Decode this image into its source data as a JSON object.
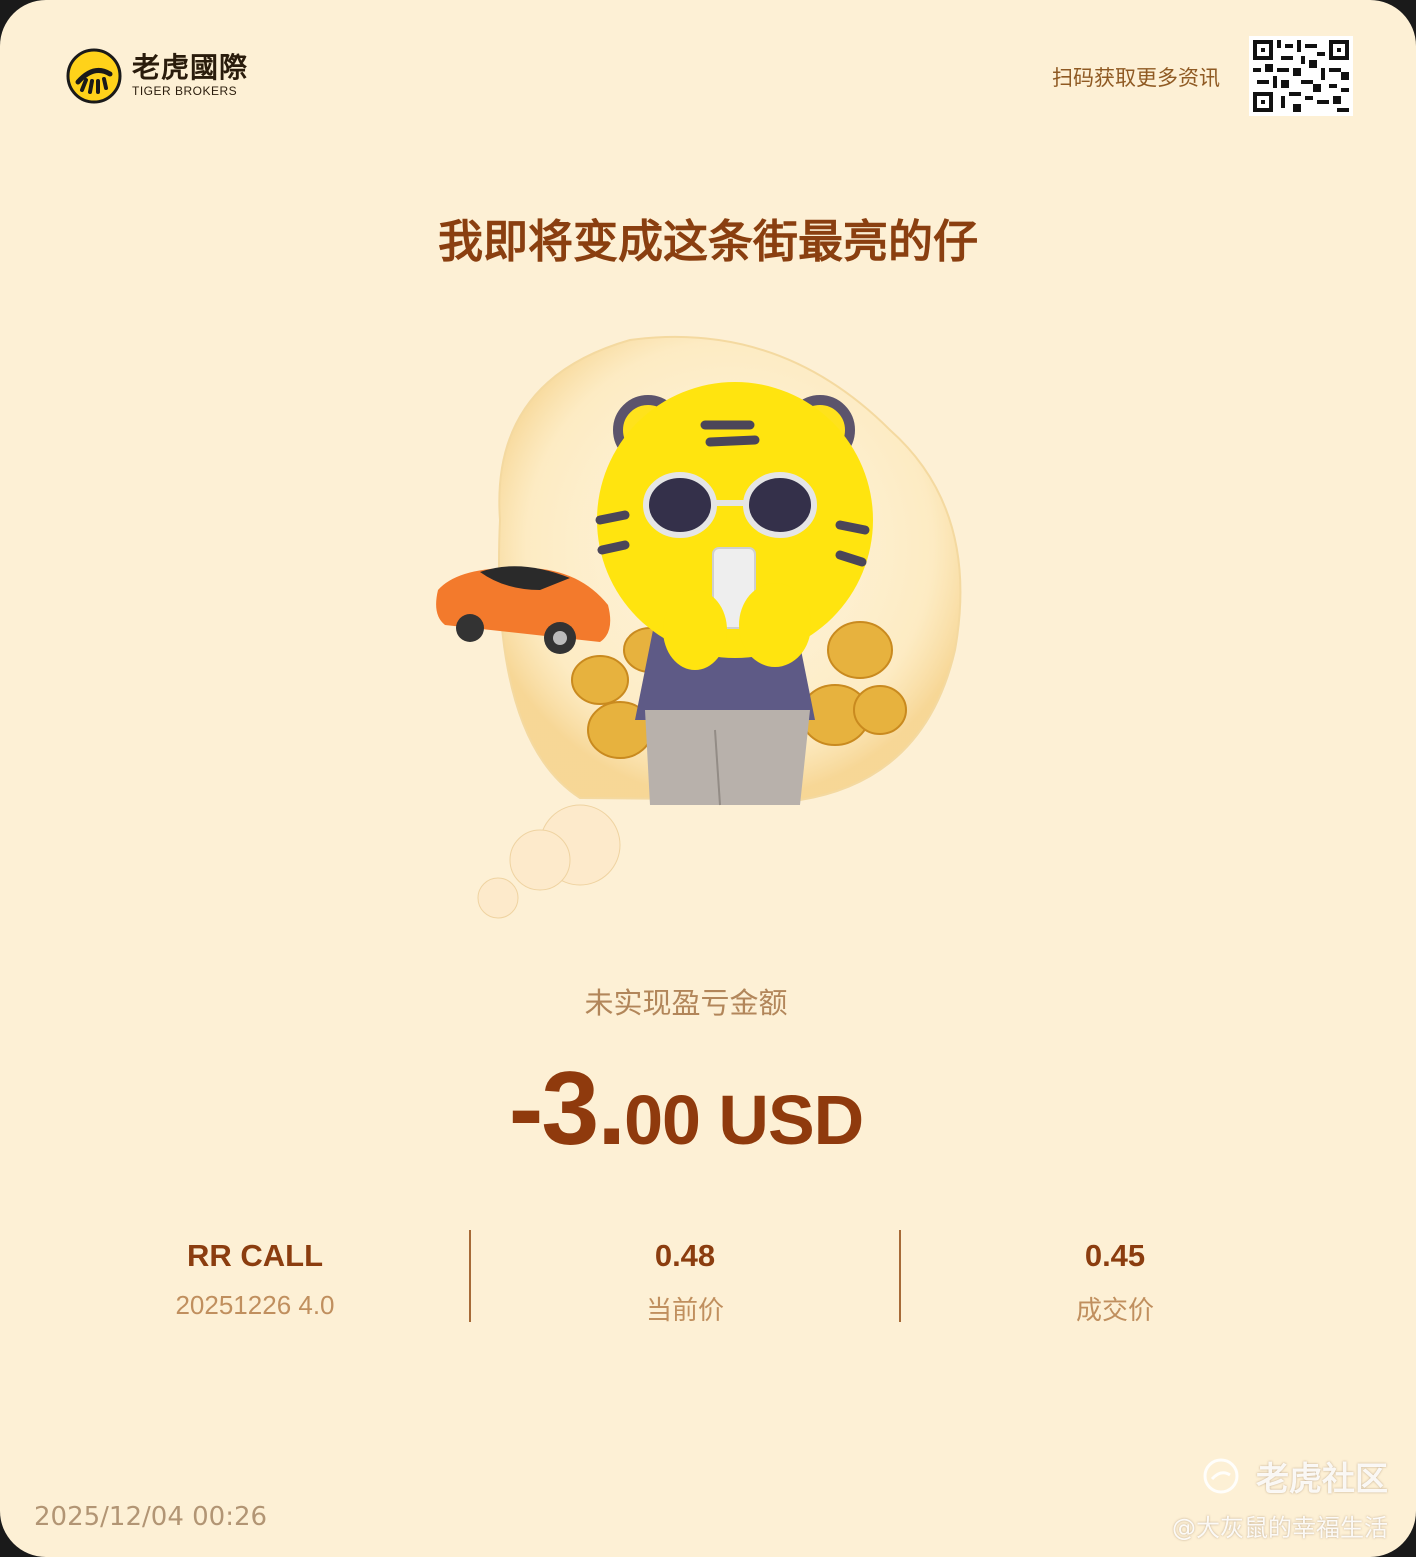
{
  "header": {
    "logo_cn": "老虎國際",
    "logo_en": "TIGER BROKERS",
    "scan_text": "扫码获取更多资讯"
  },
  "title": "我即将变成这条街最亮的仔",
  "pnl": {
    "label": "未实现盈亏金额",
    "value_int": "-3.",
    "value_rest": "00 USD"
  },
  "stats": {
    "contract": {
      "name": "RR CALL",
      "detail": "20251226 4.0"
    },
    "current": {
      "value": "0.48",
      "label": "当前价"
    },
    "filled": {
      "value": "0.45",
      "label": "成交价"
    }
  },
  "timestamp": "2025/12/04 00:26",
  "watermark": {
    "brand": "老虎社区",
    "user": "@大灰鼠的幸福生活"
  },
  "colors": {
    "background": "#fdf0d5",
    "accent": "#8f3a0d",
    "muted": "#c08f5e"
  }
}
